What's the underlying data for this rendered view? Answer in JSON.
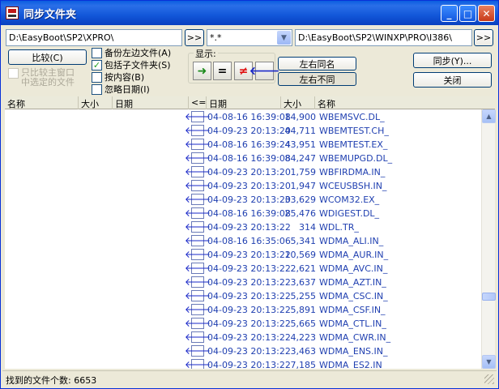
{
  "window": {
    "title": "同步文件夹"
  },
  "left": {
    "path": "D:\\EasyBoot\\SP2\\XPRO\\",
    "browse_label": ">>"
  },
  "filter": {
    "value": "*.*"
  },
  "right": {
    "path": "D:\\EasyBoot\\SP2\\WINXP\\PRO\\I386\\",
    "browse_label": ">>"
  },
  "buttons": {
    "compare": "比较(C)",
    "sync": "同步(Y)...",
    "close": "关闭",
    "same": "左右同名",
    "diff": "左右不同"
  },
  "options": {
    "compare_main_line1": "只比较主窗口",
    "compare_main_line2": "中选定的文件",
    "backup_left": "备份左边文件(A)",
    "include_subfolders": "包括子文件夹(S)",
    "by_content": "按内容(B)",
    "ignore_date": "忽略日期(I)"
  },
  "display": {
    "label": "显示:",
    "equal": "=",
    "notequal": "≠"
  },
  "columns": {
    "left_name": "名称",
    "left_size": "大小",
    "left_date": "日期",
    "dir": "<=",
    "right_date": "日期",
    "right_size": "大小",
    "right_name": "名称"
  },
  "rows": [
    {
      "date": "04-08-16 16:39:08",
      "size": "14,900",
      "name": "WBEMSVC.DL_"
    },
    {
      "date": "04-09-23 20:13:20",
      "size": "44,711",
      "name": "WBEMTEST.CH_"
    },
    {
      "date": "04-08-16 16:39:24",
      "size": "43,951",
      "name": "WBEMTEST.EX_"
    },
    {
      "date": "04-08-16 16:39:08",
      "size": "84,247",
      "name": "WBEMUPGD.DL_"
    },
    {
      "date": "04-09-23 20:13:20",
      "size": "1,759",
      "name": "WBFIRDMA.IN_"
    },
    {
      "date": "04-09-23 20:13:20",
      "size": "1,947",
      "name": "WCEUSBSH.IN_"
    },
    {
      "date": "04-09-23 20:13:20",
      "size": "33,629",
      "name": "WCOM32.EX_"
    },
    {
      "date": "04-08-16 16:39:08",
      "size": "25,476",
      "name": "WDIGEST.DL_"
    },
    {
      "date": "04-09-23 20:13:22",
      "size": "314",
      "name": "WDL.TR_"
    },
    {
      "date": "04-08-16 16:35:06",
      "size": "5,341",
      "name": "WDMA_ALI.IN_"
    },
    {
      "date": "04-09-23 20:13:22",
      "size": "10,569",
      "name": "WDMA_AUR.IN_"
    },
    {
      "date": "04-09-23 20:13:22",
      "size": "2,621",
      "name": "WDMA_AVC.IN_"
    },
    {
      "date": "04-09-23 20:13:22",
      "size": "3,637",
      "name": "WDMA_AZT.IN_"
    },
    {
      "date": "04-09-23 20:13:22",
      "size": "5,255",
      "name": "WDMA_CSC.IN_"
    },
    {
      "date": "04-09-23 20:13:22",
      "size": "5,891",
      "name": "WDMA_CSF.IN_"
    },
    {
      "date": "04-09-23 20:13:22",
      "size": "5,665",
      "name": "WDMA_CTL.IN_"
    },
    {
      "date": "04-09-23 20:13:22",
      "size": "4,223",
      "name": "WDMA_CWR.IN_"
    },
    {
      "date": "04-09-23 20:13:22",
      "size": "3,463",
      "name": "WDMA_ENS.IN_"
    },
    {
      "date": "04-09-23 20:13:22",
      "size": "7,185",
      "name": "WDMA_ES2.IN_"
    }
  ],
  "status": {
    "text": "找到的文件个数: 6653"
  },
  "colors": {
    "title_bar": "#0a5ee0",
    "row_text": "#1f3fb0",
    "arrow_blue": "#1a28c8",
    "arrow_green": "#1a8a1a",
    "notequal_red": "#e01010"
  },
  "icons": {
    "direction": "arrow-left-icon",
    "show_right": "arrow-right-icon",
    "show_left": "arrow-left-icon"
  }
}
